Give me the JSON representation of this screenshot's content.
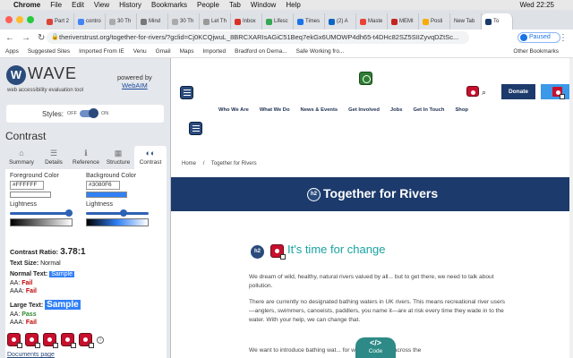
{
  "menubar": {
    "apple": "",
    "app": "Chrome",
    "items": [
      "File",
      "Edit",
      "View",
      "History",
      "Bookmarks",
      "People",
      "Tab",
      "Window",
      "Help"
    ],
    "clock": "Wed 22:25"
  },
  "tabs": [
    "Part 2",
    "contro",
    "30 Th",
    "Mind",
    "30 Th",
    "Let Th",
    "Inbox",
    "Lifesc",
    "Times",
    "(2) A",
    "Maste",
    "MEMI",
    "Posti",
    "New Tab",
    "To"
  ],
  "address": {
    "url": "theriverstrust.org/together-for-rivers/?gclid=Cj0KCQjwuL_8BRCXARIsAGiC51Beq7ekGx6UMOWP4dh65-t4DHc82SZ5SIIZyvqDZtSc...",
    "profile": "Paused"
  },
  "bookmarks": {
    "items": [
      "Apps",
      "Suggested Sites",
      "Imported From IE",
      "Venu",
      "Gmail",
      "Maps",
      "Imported",
      "Bradford on Dema...",
      "Safe Working fro..."
    ],
    "other": "Other Bookmarks"
  },
  "wave": {
    "logo": "W",
    "title": "WAVE",
    "subtitle": "web accessibility evaluation tool",
    "powered_by": "powered by",
    "webaim": "WebAIM",
    "styles_label": "Styles:",
    "styles_off": "OFF",
    "styles_on": "ON",
    "section": "Contrast",
    "tabs": [
      {
        "label": "Summary",
        "icon": "⌂"
      },
      {
        "label": "Details",
        "icon": "☰"
      },
      {
        "label": "Reference",
        "icon": "ℹ"
      },
      {
        "label": "Structure",
        "icon": "▦"
      },
      {
        "label": "Contrast",
        "icon": "◐◐"
      }
    ],
    "fg_label": "Foreground Color",
    "fg_hex": "#FFFFFF",
    "bg_label": "Background Color",
    "bg_hex": "#3080F6",
    "lightness": "Lightness",
    "ratio_label": "Contrast Ratio:",
    "ratio_value": "3.78:1",
    "text_size_label": "Text Size:",
    "text_size_value": "Normal",
    "normal_label": "Normal Text:",
    "large_label": "Large Text:",
    "sample": "Sample",
    "aa_label": "AA:",
    "aaa_label": "AAA:",
    "normal_aa": "Fail",
    "normal_aaa": "Fail",
    "large_aa": "Pass",
    "large_aaa": "Fail",
    "doc_link": "Documents page"
  },
  "site": {
    "nav": [
      "Who We Are",
      "What We Do",
      "News & Events",
      "Get Involved",
      "Jobs",
      "Get In Touch",
      "Shop"
    ],
    "donate": "Donate",
    "breadcrumb": [
      "Home",
      "/",
      "Together for Rivers"
    ],
    "banner_title": "Together for Rivers",
    "h2_badge": "h2",
    "section_title": "It's time for change",
    "para1": "We dream of wild, healthy, natural rivers valued by all... but to get there, we need to talk about pollution.",
    "para2": "There are currently no designated bathing waters in UK rivers. This means recreational river users—anglers, swimmers, canoeists, paddlers, you name it—are at risk every time they wade in to the water. With your help, we can change that.",
    "para3": "We want to introduce bathing wat... for well-used rivers across the",
    "code_tag": "</>",
    "code_label": "Code"
  },
  "colors": {
    "brand_navy": "#1c3a6b",
    "accent_teal": "#1aa3a0",
    "wave_error": "#c8102e",
    "sample_bg": "#3080f6"
  }
}
